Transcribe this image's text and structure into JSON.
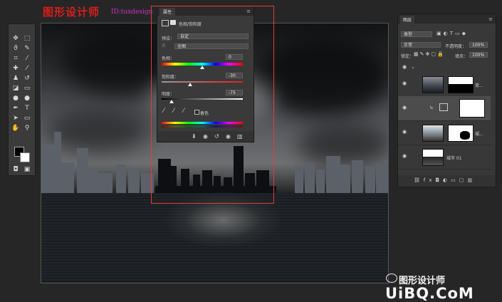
{
  "header": {
    "title": "图形设计师",
    "id_text": "ID:tuxdesign"
  },
  "properties_panel": {
    "tab_label": "属性",
    "adjustment_name": "色相/饱和度",
    "preset_label": "预设：",
    "preset_value": "自定",
    "range_value": "全图",
    "hue_label": "色相：",
    "hue_value": "0",
    "saturation_label": "饱和度：",
    "saturation_value": "-30",
    "lightness_label": "明度：",
    "lightness_value": "-75",
    "colorize_label": "着色",
    "slider_positions": {
      "hue": 0.5,
      "saturation": 0.35,
      "lightness": 0.125
    }
  },
  "layers_panel": {
    "tab_label": "图层",
    "filter_kind": "类型",
    "blend_mode": "正常",
    "opacity_label": "不透明度：",
    "opacity_value": "100%",
    "lock_label": "锁定：",
    "fill_label": "填充：",
    "fill_value": "100%",
    "layers": [
      {
        "name": "背..."
      },
      {
        "name": ""
      },
      {
        "name": "城..."
      },
      {
        "name": "城市 01"
      }
    ]
  },
  "watermark": {
    "brand": "图形设计师",
    "site": "UiBQ.CoM"
  },
  "colors": {
    "accent_red": "#e53b3b",
    "title_red": "#d81e1e",
    "id_purple": "#c832c8"
  }
}
